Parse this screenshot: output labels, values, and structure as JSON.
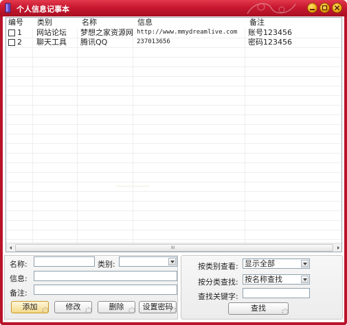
{
  "window": {
    "title": "个人信息记事本",
    "accent": "#c81830"
  },
  "list": {
    "columns": [
      "编号",
      "类别",
      "名称",
      "信息",
      "备注"
    ],
    "rows": [
      {
        "id": "1",
        "category": "网站论坛",
        "name": "梦想之家资源网",
        "info": "http://www.mmydreamlive.com",
        "note": "账号123456",
        "checked": false
      },
      {
        "id": "2",
        "category": "聊天工具",
        "name": "腾讯QQ",
        "info": "237013656",
        "note": "密码123456",
        "checked": false
      }
    ],
    "scroll_grip": "III"
  },
  "form": {
    "name_label": "名称:",
    "category_label": "类别:",
    "info_label": "信息:",
    "note_label": "备注:",
    "name_value": "",
    "category_value": "",
    "info_value": "",
    "note_value": "",
    "add_button": "添加",
    "edit_button": "修改",
    "delete_button": "删除",
    "password_button": "设置密码"
  },
  "search": {
    "view_by_category_label": "按类别查看:",
    "view_by_category_value": "显示全部",
    "search_by_category_label": "按分类查找:",
    "search_by_category_value": "按名称查找",
    "keyword_label": "查找关键字:",
    "keyword_value": "",
    "search_button": "查找"
  },
  "icons": [
    "app-notebook-icon",
    "minimize-icon",
    "maximize-icon",
    "close-icon",
    "dropdown-arrow-icon",
    "gear-decoration-icon"
  ]
}
